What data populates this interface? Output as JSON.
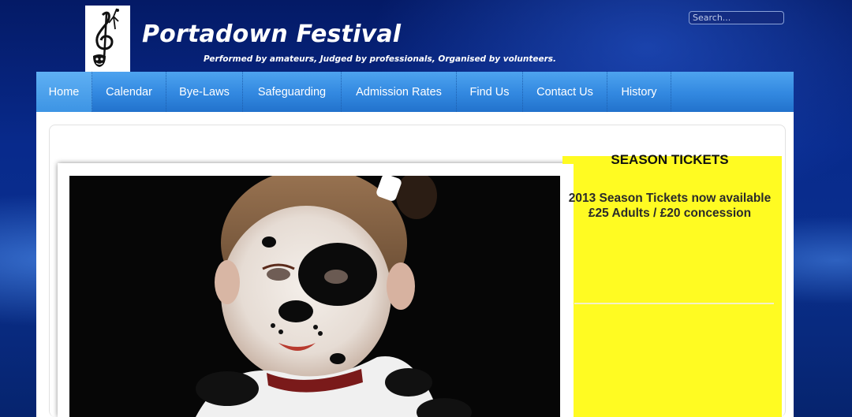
{
  "header": {
    "site_title": "Portadown Festival",
    "tagline": "Performed by amateurs, Judged by professionals, Organised by volunteers.",
    "logo_icon": "treble-clef-dancer-mask-icon"
  },
  "search": {
    "placeholder": "Search..."
  },
  "nav": {
    "items": [
      {
        "label": "Home"
      },
      {
        "label": "Calendar"
      },
      {
        "label": "Bye-Laws"
      },
      {
        "label": "Safeguarding"
      },
      {
        "label": "Admission Rates"
      },
      {
        "label": "Find Us"
      },
      {
        "label": "Contact Us"
      },
      {
        "label": "History"
      }
    ]
  },
  "sidebar": {
    "heading": "SEASON TICKETS",
    "line1": "2013 Season Tickets now available",
    "line2": "£25 Adults / £20 concession"
  },
  "colors": {
    "nav_blue": "#3288e0",
    "sidebar_yellow": "#fffb22",
    "background_navy": "#082a8c"
  }
}
